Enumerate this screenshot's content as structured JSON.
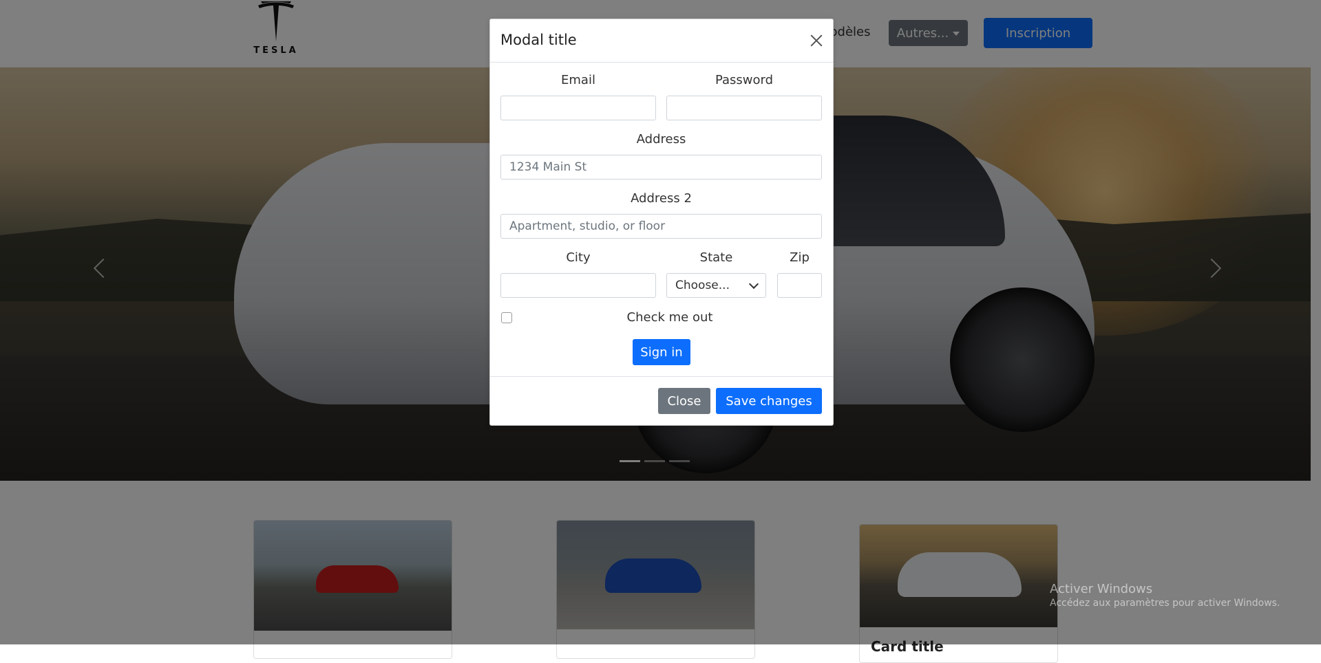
{
  "navbar": {
    "brand_text": "TESLA",
    "link_label": "Modèles",
    "dropdown_label": "Autres...",
    "signup_label": "Inscription"
  },
  "carousel": {
    "slides_count": 3,
    "active_index": 0
  },
  "cards": [
    {
      "title": ""
    },
    {
      "title": ""
    },
    {
      "title": "Card title"
    }
  ],
  "modal": {
    "title": "Modal title",
    "email_label": "Email",
    "password_label": "Password",
    "address_label": "Address",
    "address_placeholder": "1234 Main St",
    "address2_label": "Address 2",
    "address2_placeholder": "Apartment, studio, or floor",
    "city_label": "City",
    "state_label": "State",
    "state_selected": "Choose...",
    "zip_label": "Zip",
    "check_label": "Check me out",
    "signin_label": "Sign in",
    "close_label": "Close",
    "save_label": "Save changes"
  },
  "windows_watermark": {
    "line1": "Activer Windows",
    "line2": "Accédez aux paramètres pour activer Windows."
  },
  "colors": {
    "primary": "#0d6efd",
    "secondary": "#6c757d",
    "backdrop": "rgba(0,0,0,0.5)"
  }
}
